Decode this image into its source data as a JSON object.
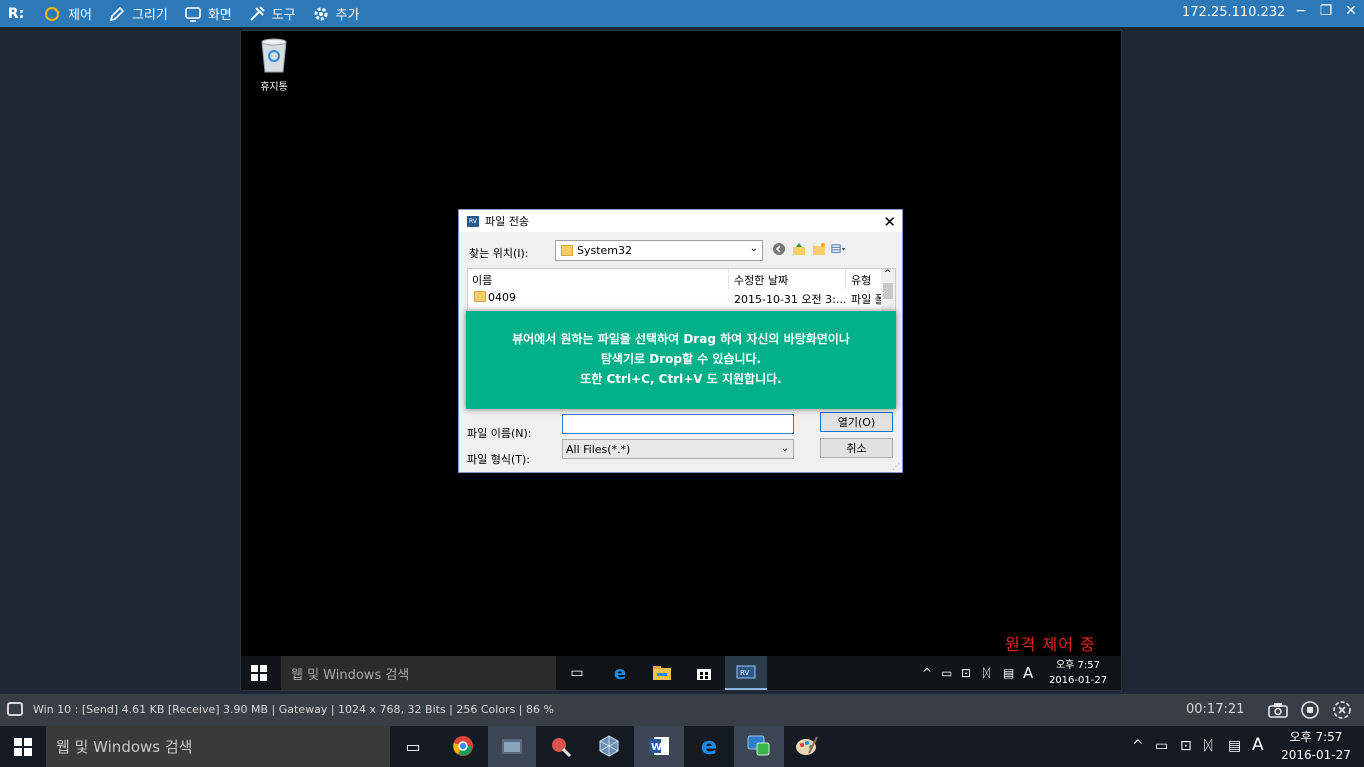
{
  "toolbar": {
    "logo": "R:",
    "items": [
      {
        "icon": "control-icon",
        "label": "제어"
      },
      {
        "icon": "pen-icon",
        "label": "그리기"
      },
      {
        "icon": "monitor-icon",
        "label": "화면"
      },
      {
        "icon": "tools-icon",
        "label": "도구"
      },
      {
        "icon": "gear-icon",
        "label": "추가"
      }
    ],
    "ip": "172.25.110.232",
    "window_controls": {
      "minimize": "−",
      "restore": "❐",
      "close": "✕"
    }
  },
  "desktop": {
    "recycle_bin_label": "휴지통"
  },
  "dialog": {
    "title": "파일 전송",
    "look_in_label": "찾는 위치(I):",
    "look_in_value": "System32",
    "columns": {
      "name": "이름",
      "modified": "수정한 날짜",
      "type": "유형"
    },
    "rows": [
      {
        "name": "0409",
        "modified": "2015-10-31 오전 3:...",
        "type": "파일 폴"
      }
    ],
    "file_name_label": "파일 이름(N):",
    "file_name_value": "",
    "file_type_label": "파일 형식(T):",
    "file_type_value": "All Files(*.*)",
    "open_button": "열기(O)",
    "cancel_button": "취소"
  },
  "tooltip": {
    "line1": "뷰어에서 원하는 파일을 선택하여 Drag 하여 자신의 바탕화면이나",
    "line2": "탐색기로 Drop할 수 있습니다.",
    "line3": "또한 Ctrl+C, Ctrl+V 도 지원합니다."
  },
  "remote_status": "원격 제어 중",
  "remote_taskbar": {
    "search_placeholder": "웹 및 Windows 검색",
    "tray_lang": "A",
    "clock_time": "오후 7:57",
    "clock_date": "2016-01-27"
  },
  "statusbar": {
    "text": "Win 10 : [Send] 4.61 KB  [Receive] 3.90 MB | Gateway | 1024 x 768, 32 Bits | 256 Colors | 86 %",
    "timer": "00:17:21"
  },
  "local_taskbar": {
    "search_placeholder": "웹 및 Windows 검색",
    "tray_lang": "A",
    "clock_time": "오후 7:57",
    "clock_date": "2016-01-27"
  },
  "colors": {
    "toolbar": "#2d78b6",
    "tooltip": "#02b189",
    "remote_status": "#e5221b"
  }
}
